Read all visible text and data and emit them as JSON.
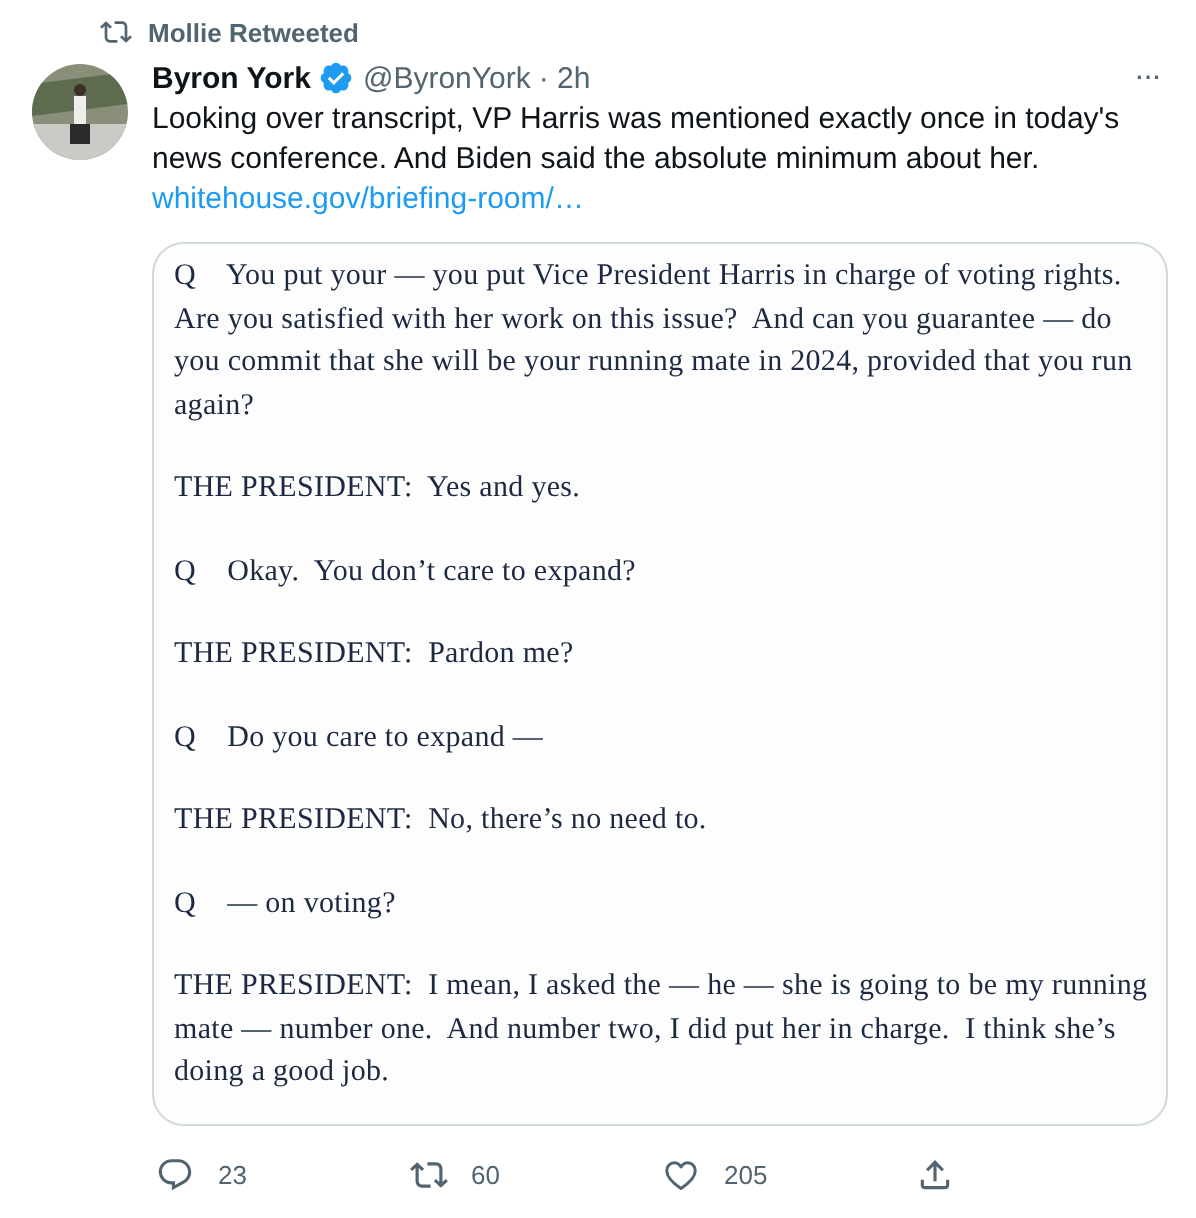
{
  "social_context": "Mollie Retweeted",
  "author": {
    "name": "Byron York",
    "verified": true,
    "handle": "@ByronYork",
    "time": "· 2h"
  },
  "more": "···",
  "text": "Looking over transcript, VP Harris was mentioned exactly once in today's news conference. And Biden said the absolute minimum about her.",
  "link": "whitehouse.gov/briefing-room/…",
  "transcript": [
    {
      "text": "Q    You put your — you put Vice President Harris in charge of voting rights.  Are you satisfied with her work on this issue?  And can you guarantee — do you commit that she will be your running mate in 2024, provided that you run again?"
    },
    {
      "text": "THE PRESIDENT:  Yes and yes."
    },
    {
      "text": "Q    Okay.  You don’t care to expand?"
    },
    {
      "text": "THE PRESIDENT:  Pardon me?"
    },
    {
      "text": "Q    Do you care to expand —"
    },
    {
      "text": "THE PRESIDENT:  No, there’s no need to."
    },
    {
      "text": "Q    — on voting?"
    },
    {
      "text": "THE PRESIDENT:  I mean, I asked the — he — she is going to be my running mate — number one.  And number two, I did put her in charge.  I think she’s doing a good job."
    }
  ],
  "actions": [
    {
      "kind": "reply",
      "count": "23"
    },
    {
      "kind": "retweet",
      "count": "60"
    },
    {
      "kind": "like",
      "count": "205"
    },
    {
      "kind": "share"
    }
  ]
}
